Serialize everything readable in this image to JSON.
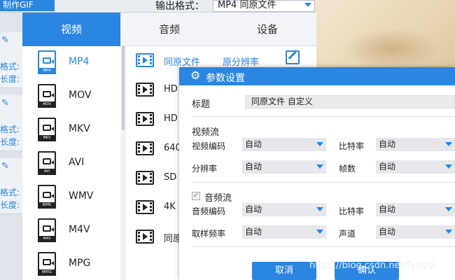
{
  "topbar": {
    "gif_label": "制作GIF",
    "output_label": "输出格式：",
    "output_value": "MP4  同原文件"
  },
  "tasks": [
    {
      "t1": "格式:",
      "t2": "长度:"
    },
    {
      "t1": "格式:",
      "t2": "长度:"
    },
    {
      "t1": "格式:",
      "t2": "长度:"
    }
  ],
  "format_window": {
    "tabs": [
      {
        "label": "视频"
      },
      {
        "label": "音频"
      },
      {
        "label": "设备"
      }
    ],
    "formats": [
      {
        "label": "MP4",
        "tag": "MP4"
      },
      {
        "label": "MOV",
        "tag": "MOV"
      },
      {
        "label": "MKV",
        "tag": "MKV"
      },
      {
        "label": "AVI",
        "tag": "AVI"
      },
      {
        "label": "WMV",
        "tag": "WMV"
      },
      {
        "label": "M4V",
        "tag": "M4V"
      },
      {
        "label": "MPG",
        "tag": "MPEG"
      }
    ],
    "resolutions": [
      {
        "name": "同原文件",
        "value": "原分辨率"
      },
      {
        "name": "HD"
      },
      {
        "name": "HD"
      },
      {
        "name": "640"
      },
      {
        "name": "SD"
      },
      {
        "name": "4K"
      },
      {
        "name": "同原"
      }
    ]
  },
  "dialog": {
    "title": "参数设置",
    "title_label": "标题",
    "title_value": "同原文件 自定义",
    "video_section": "视频流",
    "video_codec_label": "视频编码",
    "video_codec": "自动",
    "bitrate_label": "比特率",
    "bitrate": "自动",
    "resolution_label": "分辨率",
    "resolution": "自动",
    "framerate_label": "帧数",
    "framerate": "自动",
    "audio_section": "音频流",
    "audio_codec_label": "音频编码",
    "audio_codec": "自动",
    "audio_bitrate_label": "比特率",
    "audio_bitrate": "自动",
    "samplerate_label": "取样频率",
    "samplerate": "自动",
    "channel_label": "声道",
    "channel": "自动",
    "cancel_label": "取消",
    "ok_label": "确认"
  },
  "watermark": "https://blog.csdn.net/Tybyqi",
  "colors": {
    "accent": "#2a86e0"
  }
}
